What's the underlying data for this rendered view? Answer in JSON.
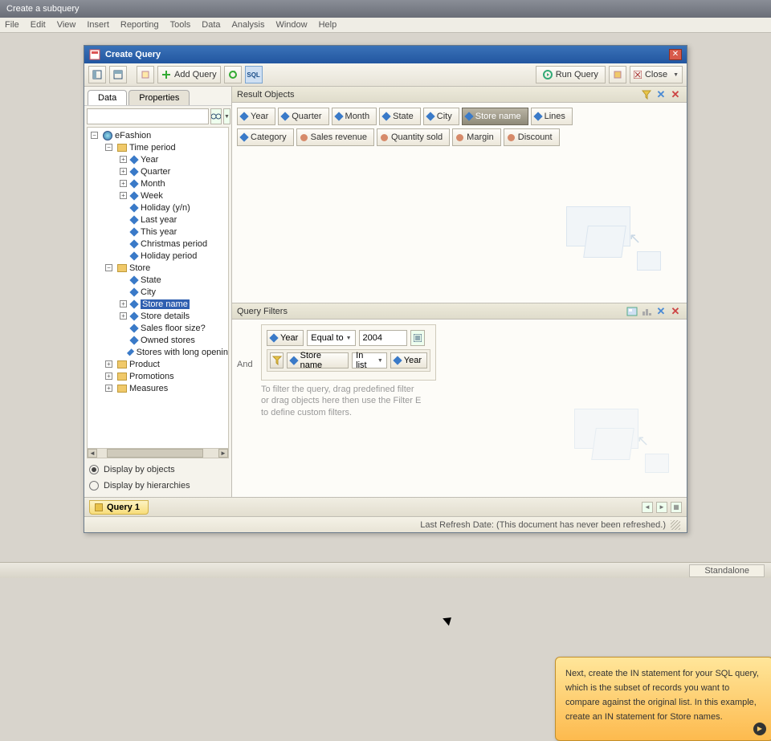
{
  "app": {
    "title": "Create a subquery"
  },
  "menubar": [
    "File",
    "Edit",
    "View",
    "Insert",
    "Reporting",
    "Tools",
    "Data",
    "Analysis",
    "Window",
    "Help"
  ],
  "modal": {
    "title": "Create Query"
  },
  "toolbar": {
    "add_query": "Add Query",
    "run_query": "Run Query",
    "close": "Close"
  },
  "left_panel": {
    "tabs": {
      "data": "Data",
      "properties": "Properties"
    },
    "active_tab": "data",
    "tree": {
      "root": "eFashion",
      "time_period": {
        "label": "Time period",
        "children": [
          "Year",
          "Quarter",
          "Month",
          "Week",
          "Holiday (y/n)",
          "Last year",
          "This year",
          "Christmas period",
          "Holiday period"
        ]
      },
      "store": {
        "label": "Store",
        "children_plain": [
          "State",
          "City"
        ],
        "children_expand": [
          "Store name",
          "Store details"
        ],
        "children_tail": [
          "Sales floor size?",
          "Owned stores",
          "Stores with long openin"
        ],
        "selected": "Store name"
      },
      "others": [
        "Product",
        "Promotions",
        "Measures"
      ]
    },
    "display": {
      "by_objects": "Display by objects",
      "by_hierarchies": "Display by hierarchies",
      "selected": "by_objects"
    }
  },
  "result_objects": {
    "title": "Result Objects",
    "row1": [
      "Year",
      "Quarter",
      "Month",
      "State",
      "City",
      "Store name",
      "Lines"
    ],
    "selected": "Store name",
    "row2_dims": [
      "Category"
    ],
    "row2_metrics": [
      "Sales revenue",
      "Quantity sold",
      "Margin",
      "Discount"
    ]
  },
  "query_filters": {
    "title": "Query Filters",
    "and": "And",
    "row1": {
      "field": "Year",
      "op": "Equal to",
      "value": "2004"
    },
    "row2": {
      "field": "Store name",
      "op": "In list",
      "sub": "Year"
    },
    "hint1": "To filter the query, drag predefined filter",
    "hint2": "or drag objects here then use the Filter E",
    "hint3": "to define custom filters."
  },
  "tooltip": "Next, create the IN statement for your SQL query, which is the subset of records you want to compare against the original list. In this example, create an IN statement for Store names.",
  "bottom_tab": "Query 1",
  "status": "Last Refresh Date: (This document has never been refreshed.)",
  "app_status": "Standalone"
}
